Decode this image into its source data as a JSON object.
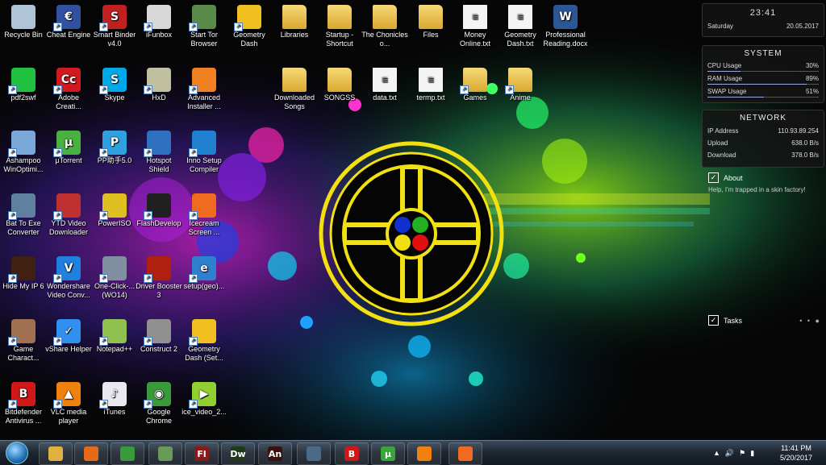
{
  "desktop_icons": [
    {
      "label": "Recycle Bin",
      "icon": "recycle-bin-icon"
    },
    {
      "label": "Cheat Engine",
      "icon": "cheat-engine-icon"
    },
    {
      "label": "Smart Binder v4.0",
      "icon": "smart-binder-icon"
    },
    {
      "label": "iFunbox",
      "icon": "ifunbox-icon"
    },
    {
      "label": "Start Tor Browser",
      "icon": "tor-browser-icon"
    },
    {
      "label": "Geometry Dash",
      "icon": "geometry-dash-icon"
    },
    {
      "label": "Libraries",
      "icon": "folder-icon"
    },
    {
      "label": "Startup - Shortcut",
      "icon": "folder-icon"
    },
    {
      "label": "The Chonicles o...",
      "icon": "folder-icon"
    },
    {
      "label": "Files",
      "icon": "folder-icon"
    },
    {
      "label": "Money Online.txt",
      "icon": "text-file-icon"
    },
    {
      "label": "Geometry Dash.txt",
      "icon": "text-file-icon"
    },
    {
      "label": "Professional Reading.docx",
      "icon": "word-document-icon"
    },
    {
      "label": "pdf2swf",
      "icon": "pdf2swf-icon"
    },
    {
      "label": "Adobe Creati...",
      "icon": "adobe-creative-cloud-icon"
    },
    {
      "label": "Skype",
      "icon": "skype-icon"
    },
    {
      "label": "HxD",
      "icon": "hxd-icon"
    },
    {
      "label": "Advanced Installer ...",
      "icon": "advanced-installer-icon"
    },
    {
      "label": "Downloaded Songs",
      "icon": "folder-icon"
    },
    {
      "label": "SONGSS",
      "icon": "folder-icon"
    },
    {
      "label": "data.txt",
      "icon": "text-file-icon"
    },
    {
      "label": "termp.txt",
      "icon": "text-file-icon"
    },
    {
      "label": "Games",
      "icon": "folder-icon"
    },
    {
      "label": "Anime",
      "icon": "folder-icon"
    },
    {
      "label": "Ashampoo WinOptimi...",
      "icon": "ashampoo-icon"
    },
    {
      "label": "µTorrent",
      "icon": "utorrent-icon"
    },
    {
      "label": "PP助手5.0",
      "icon": "pp-assistant-icon"
    },
    {
      "label": "Hotspot Shield",
      "icon": "hotspot-shield-icon"
    },
    {
      "label": "Inno Setup Compiler",
      "icon": "inno-setup-icon"
    },
    {
      "label": "Bat To Exe Converter",
      "icon": "bat-to-exe-icon"
    },
    {
      "label": "YTD Video Downloader",
      "icon": "ytd-downloader-icon"
    },
    {
      "label": "PowerISO",
      "icon": "poweriso-icon"
    },
    {
      "label": "FlashDevelop",
      "icon": "flashdevelop-icon"
    },
    {
      "label": "Icecream Screen ...",
      "icon": "icecream-screen-icon"
    },
    {
      "label": "Hide My IP 6",
      "icon": "hide-my-ip-icon"
    },
    {
      "label": "Wondershare Video Conv...",
      "icon": "wondershare-icon"
    },
    {
      "label": "One-Click-... (WO14)",
      "icon": "one-click-icon"
    },
    {
      "label": "Driver Booster 3",
      "icon": "driver-booster-icon"
    },
    {
      "label": "setup(geo)...",
      "icon": "setup-icon"
    },
    {
      "label": "Game Charact...",
      "icon": "game-character-icon"
    },
    {
      "label": "vShare Helper",
      "icon": "vshare-icon"
    },
    {
      "label": "Notepad++",
      "icon": "notepadpp-icon"
    },
    {
      "label": "Construct 2",
      "icon": "construct2-icon"
    },
    {
      "label": "Geometry Dash (Set...",
      "icon": "geometry-dash-icon"
    },
    {
      "label": "Bitdefender Antivirus ...",
      "icon": "bitdefender-icon"
    },
    {
      "label": "VLC media player",
      "icon": "vlc-icon"
    },
    {
      "label": "iTunes",
      "icon": "itunes-icon"
    },
    {
      "label": "Google Chrome",
      "icon": "chrome-icon"
    },
    {
      "label": "ice_video_2...",
      "icon": "video-file-icon"
    }
  ],
  "gadgets": {
    "clock": {
      "time": "23:41",
      "day": "Saturday",
      "date": "20.05.2017"
    },
    "system": {
      "title": "SYSTEM",
      "rows": [
        {
          "label": "CPU Usage",
          "value": "30%",
          "level": 0.3
        },
        {
          "label": "RAM Usage",
          "value": "89%",
          "level": 0.89
        },
        {
          "label": "SWAP Usage",
          "value": "51%",
          "level": 0.51
        }
      ]
    },
    "network": {
      "title": "NETWORK",
      "rows": [
        {
          "label": "IP Address",
          "value": "110.93.89.254"
        },
        {
          "label": "Upload",
          "value": "638.0 B/s"
        },
        {
          "label": "Download",
          "value": "378.0 B/s"
        }
      ]
    },
    "about": {
      "title": "About",
      "text": "Help, I'm trapped in a skin factory!"
    },
    "tasks": {
      "title": "Tasks"
    }
  },
  "taskbar": {
    "pinned": [
      {
        "name": "explorer",
        "icon": "folder-icon",
        "glyph": "",
        "color": "#e0b040"
      },
      {
        "name": "firefox",
        "icon": "firefox-icon",
        "glyph": "",
        "color": "#e66a1a"
      },
      {
        "name": "chrome",
        "icon": "chrome-icon",
        "glyph": "",
        "color": "#3a9a3a"
      },
      {
        "name": "tor",
        "icon": "tor-browser-icon",
        "glyph": "",
        "color": "#6a9a5a"
      },
      {
        "name": "flash",
        "icon": "adobe-flash-icon",
        "glyph": "Fl",
        "color": "#8a1a1a"
      },
      {
        "name": "dreamweaver",
        "icon": "adobe-dreamweaver-icon",
        "glyph": "Dw",
        "color": "#1f3a1a"
      },
      {
        "name": "animate",
        "icon": "adobe-animate-icon",
        "glyph": "An",
        "color": "#3a1010"
      },
      {
        "name": "remote",
        "icon": "monitor-icon",
        "glyph": "",
        "color": "#4a6a8a"
      },
      {
        "name": "bitdefender",
        "icon": "bitdefender-icon",
        "glyph": "B",
        "color": "#d01818"
      },
      {
        "name": "utorrent",
        "icon": "utorrent-icon",
        "glyph": "µ",
        "color": "#3aa53a"
      },
      {
        "name": "vlc",
        "icon": "vlc-icon",
        "glyph": "",
        "color": "#f08010"
      },
      {
        "name": "icecream",
        "icon": "icecream-screen-icon",
        "glyph": "",
        "color": "#f06a20"
      }
    ],
    "clock": {
      "time": "11:41 PM",
      "date": "5/20/2017"
    }
  },
  "colors": {
    "gadget_accent": "#9ad",
    "logo_yellow": "#f2e010"
  }
}
